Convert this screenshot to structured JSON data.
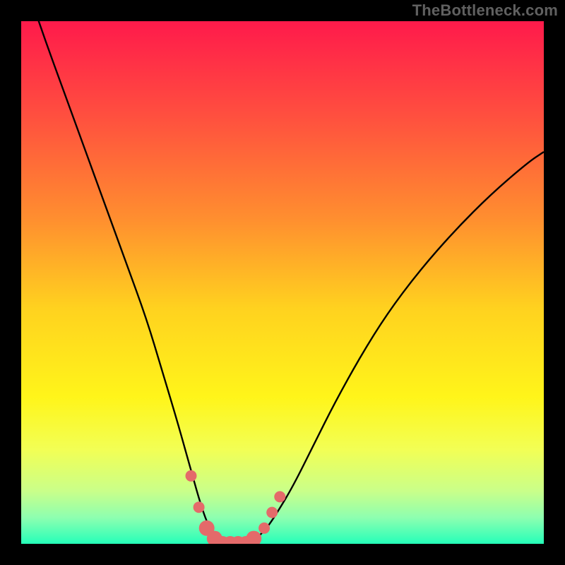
{
  "watermark": "TheBottleneck.com",
  "chart_data": {
    "type": "line",
    "title": "",
    "xlabel": "",
    "ylabel": "",
    "xlim": [
      0,
      100
    ],
    "ylim": [
      0,
      100
    ],
    "background": {
      "type": "vertical-gradient",
      "stops": [
        {
          "pos": 0.0,
          "color": "#ff1a4b"
        },
        {
          "pos": 0.18,
          "color": "#ff4f3f"
        },
        {
          "pos": 0.38,
          "color": "#ff8f2f"
        },
        {
          "pos": 0.55,
          "color": "#ffd21f"
        },
        {
          "pos": 0.72,
          "color": "#fff51a"
        },
        {
          "pos": 0.82,
          "color": "#f2ff55"
        },
        {
          "pos": 0.9,
          "color": "#c9ff8a"
        },
        {
          "pos": 0.95,
          "color": "#8dffb0"
        },
        {
          "pos": 1.0,
          "color": "#25ffb9"
        }
      ]
    },
    "series": [
      {
        "name": "bottleneck-curve",
        "color": "#000000",
        "width": 2.4,
        "x": [
          0,
          4,
          8,
          12,
          16,
          20,
          24,
          27,
          30,
          32.5,
          34.5,
          36,
          37.5,
          39,
          41,
          43,
          45,
          47,
          49,
          52,
          56,
          60,
          65,
          70,
          76,
          83,
          90,
          97,
          100
        ],
        "y": [
          110,
          98,
          87,
          76,
          65,
          54,
          43,
          33,
          23,
          14,
          7,
          3,
          1,
          0,
          0,
          0,
          1,
          3,
          6,
          11,
          19,
          27,
          36,
          44,
          52,
          60,
          67,
          73,
          75
        ]
      }
    ],
    "markers": {
      "color": "#e46a6a",
      "radius_small": 8,
      "radius_large": 11,
      "points": [
        {
          "x": 32.5,
          "y": 13,
          "r": "small"
        },
        {
          "x": 34.0,
          "y": 7,
          "r": "small"
        },
        {
          "x": 35.5,
          "y": 3,
          "r": "large"
        },
        {
          "x": 37.0,
          "y": 1,
          "r": "large"
        },
        {
          "x": 38.5,
          "y": 0,
          "r": "large"
        },
        {
          "x": 40.0,
          "y": 0,
          "r": "large"
        },
        {
          "x": 41.5,
          "y": 0,
          "r": "large"
        },
        {
          "x": 43.0,
          "y": 0,
          "r": "large"
        },
        {
          "x": 44.5,
          "y": 1,
          "r": "large"
        },
        {
          "x": 46.5,
          "y": 3,
          "r": "small"
        },
        {
          "x": 48.0,
          "y": 6,
          "r": "small"
        },
        {
          "x": 49.5,
          "y": 9,
          "r": "small"
        }
      ]
    },
    "frame": {
      "color": "#000000",
      "outer": 800,
      "inset": 30
    }
  }
}
